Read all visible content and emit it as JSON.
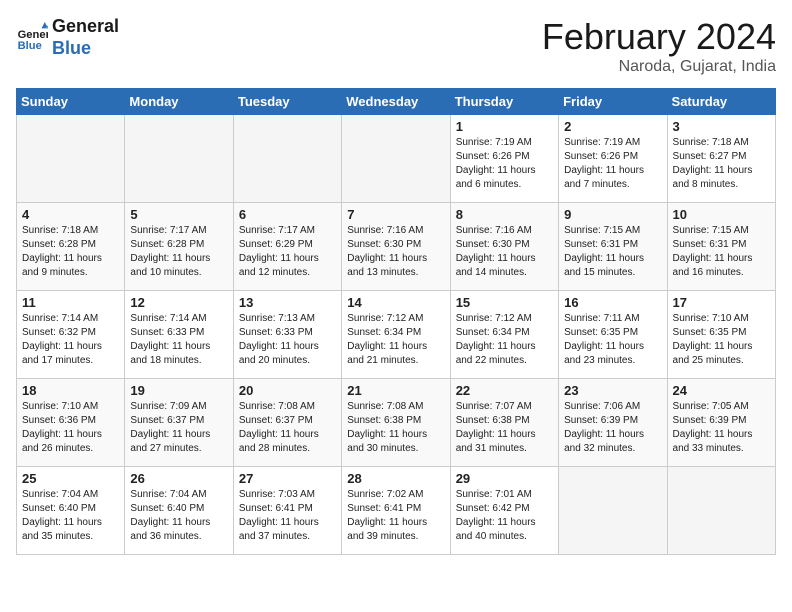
{
  "header": {
    "logo_line1": "General",
    "logo_line2": "Blue",
    "month_title": "February 2024",
    "location": "Naroda, Gujarat, India"
  },
  "weekdays": [
    "Sunday",
    "Monday",
    "Tuesday",
    "Wednesday",
    "Thursday",
    "Friday",
    "Saturday"
  ],
  "weeks": [
    [
      {
        "day": "",
        "info": ""
      },
      {
        "day": "",
        "info": ""
      },
      {
        "day": "",
        "info": ""
      },
      {
        "day": "",
        "info": ""
      },
      {
        "day": "1",
        "info": "Sunrise: 7:19 AM\nSunset: 6:26 PM\nDaylight: 11 hours and 6 minutes."
      },
      {
        "day": "2",
        "info": "Sunrise: 7:19 AM\nSunset: 6:26 PM\nDaylight: 11 hours and 7 minutes."
      },
      {
        "day": "3",
        "info": "Sunrise: 7:18 AM\nSunset: 6:27 PM\nDaylight: 11 hours and 8 minutes."
      }
    ],
    [
      {
        "day": "4",
        "info": "Sunrise: 7:18 AM\nSunset: 6:28 PM\nDaylight: 11 hours and 9 minutes."
      },
      {
        "day": "5",
        "info": "Sunrise: 7:17 AM\nSunset: 6:28 PM\nDaylight: 11 hours and 10 minutes."
      },
      {
        "day": "6",
        "info": "Sunrise: 7:17 AM\nSunset: 6:29 PM\nDaylight: 11 hours and 12 minutes."
      },
      {
        "day": "7",
        "info": "Sunrise: 7:16 AM\nSunset: 6:30 PM\nDaylight: 11 hours and 13 minutes."
      },
      {
        "day": "8",
        "info": "Sunrise: 7:16 AM\nSunset: 6:30 PM\nDaylight: 11 hours and 14 minutes."
      },
      {
        "day": "9",
        "info": "Sunrise: 7:15 AM\nSunset: 6:31 PM\nDaylight: 11 hours and 15 minutes."
      },
      {
        "day": "10",
        "info": "Sunrise: 7:15 AM\nSunset: 6:31 PM\nDaylight: 11 hours and 16 minutes."
      }
    ],
    [
      {
        "day": "11",
        "info": "Sunrise: 7:14 AM\nSunset: 6:32 PM\nDaylight: 11 hours and 17 minutes."
      },
      {
        "day": "12",
        "info": "Sunrise: 7:14 AM\nSunset: 6:33 PM\nDaylight: 11 hours and 18 minutes."
      },
      {
        "day": "13",
        "info": "Sunrise: 7:13 AM\nSunset: 6:33 PM\nDaylight: 11 hours and 20 minutes."
      },
      {
        "day": "14",
        "info": "Sunrise: 7:12 AM\nSunset: 6:34 PM\nDaylight: 11 hours and 21 minutes."
      },
      {
        "day": "15",
        "info": "Sunrise: 7:12 AM\nSunset: 6:34 PM\nDaylight: 11 hours and 22 minutes."
      },
      {
        "day": "16",
        "info": "Sunrise: 7:11 AM\nSunset: 6:35 PM\nDaylight: 11 hours and 23 minutes."
      },
      {
        "day": "17",
        "info": "Sunrise: 7:10 AM\nSunset: 6:35 PM\nDaylight: 11 hours and 25 minutes."
      }
    ],
    [
      {
        "day": "18",
        "info": "Sunrise: 7:10 AM\nSunset: 6:36 PM\nDaylight: 11 hours and 26 minutes."
      },
      {
        "day": "19",
        "info": "Sunrise: 7:09 AM\nSunset: 6:37 PM\nDaylight: 11 hours and 27 minutes."
      },
      {
        "day": "20",
        "info": "Sunrise: 7:08 AM\nSunset: 6:37 PM\nDaylight: 11 hours and 28 minutes."
      },
      {
        "day": "21",
        "info": "Sunrise: 7:08 AM\nSunset: 6:38 PM\nDaylight: 11 hours and 30 minutes."
      },
      {
        "day": "22",
        "info": "Sunrise: 7:07 AM\nSunset: 6:38 PM\nDaylight: 11 hours and 31 minutes."
      },
      {
        "day": "23",
        "info": "Sunrise: 7:06 AM\nSunset: 6:39 PM\nDaylight: 11 hours and 32 minutes."
      },
      {
        "day": "24",
        "info": "Sunrise: 7:05 AM\nSunset: 6:39 PM\nDaylight: 11 hours and 33 minutes."
      }
    ],
    [
      {
        "day": "25",
        "info": "Sunrise: 7:04 AM\nSunset: 6:40 PM\nDaylight: 11 hours and 35 minutes."
      },
      {
        "day": "26",
        "info": "Sunrise: 7:04 AM\nSunset: 6:40 PM\nDaylight: 11 hours and 36 minutes."
      },
      {
        "day": "27",
        "info": "Sunrise: 7:03 AM\nSunset: 6:41 PM\nDaylight: 11 hours and 37 minutes."
      },
      {
        "day": "28",
        "info": "Sunrise: 7:02 AM\nSunset: 6:41 PM\nDaylight: 11 hours and 39 minutes."
      },
      {
        "day": "29",
        "info": "Sunrise: 7:01 AM\nSunset: 6:42 PM\nDaylight: 11 hours and 40 minutes."
      },
      {
        "day": "",
        "info": ""
      },
      {
        "day": "",
        "info": ""
      }
    ]
  ]
}
